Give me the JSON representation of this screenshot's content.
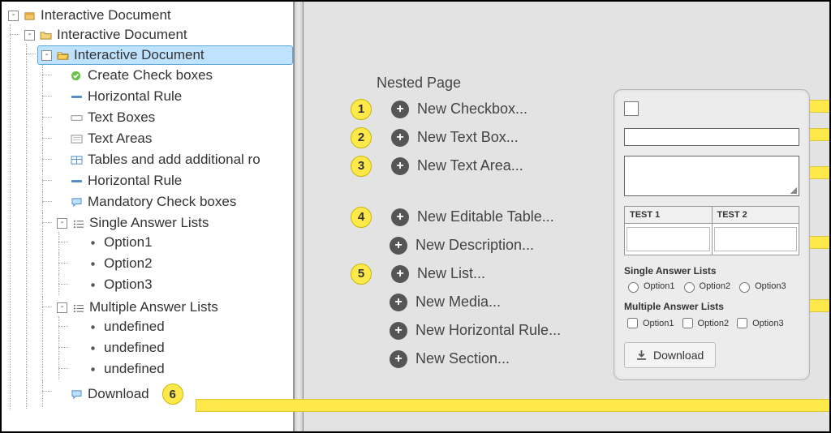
{
  "tree": {
    "root": {
      "label": "Interactive Document",
      "children": [
        {
          "label": "Interactive Document",
          "children": [
            {
              "label": "Interactive Document",
              "selected": true,
              "children": [
                {
                  "label": "Create Check boxes",
                  "icon": "check"
                },
                {
                  "label": "Horizontal Rule",
                  "icon": "hr"
                },
                {
                  "label": "Text Boxes",
                  "icon": "textbox"
                },
                {
                  "label": "Text Areas",
                  "icon": "textarea"
                },
                {
                  "label": "Tables and add additional ro",
                  "icon": "table"
                },
                {
                  "label": "Horizontal Rule",
                  "icon": "hr"
                },
                {
                  "label": "Mandatory Check boxes",
                  "icon": "comment"
                },
                {
                  "label": "Single Answer Lists",
                  "icon": "list",
                  "children": [
                    {
                      "label": "Option1",
                      "icon": "bullet"
                    },
                    {
                      "label": "Option2",
                      "icon": "bullet"
                    },
                    {
                      "label": "Option3",
                      "icon": "bullet"
                    }
                  ]
                },
                {
                  "label": "Multiple Answer Lists",
                  "icon": "list",
                  "children": [
                    {
                      "label": "undefined",
                      "icon": "bullet"
                    },
                    {
                      "label": "undefined",
                      "icon": "bullet"
                    },
                    {
                      "label": "undefined",
                      "icon": "bullet"
                    }
                  ]
                },
                {
                  "label": "Download",
                  "icon": "comment",
                  "badge": "6"
                }
              ]
            }
          ]
        }
      ]
    }
  },
  "page_title": "Nested Page",
  "actions": [
    {
      "badge": "1",
      "label": "New Checkbox...",
      "arrow": true
    },
    {
      "badge": "2",
      "label": "New Text Box...",
      "arrow": true
    },
    {
      "badge": "3",
      "label": "New Text Area...",
      "arrow": true
    },
    {
      "gap": true
    },
    {
      "badge": "4",
      "label": "New Editable Table...",
      "arrow": true
    },
    {
      "badge": "",
      "label": "New Description...",
      "arrow": false
    },
    {
      "badge": "5",
      "label": "New List...",
      "arrow": true
    },
    {
      "badge": "",
      "label": "New Media...",
      "arrow": false
    },
    {
      "badge": "",
      "label": "New Horizontal Rule...",
      "arrow": false
    },
    {
      "badge": "",
      "label": "New Section...",
      "arrow": false
    }
  ],
  "preview": {
    "table_headers": [
      "TEST 1",
      "TEST 2"
    ],
    "single_title": "Single Answer Lists",
    "single_opts": [
      "Option1",
      "Option2",
      "Option3"
    ],
    "multi_title": "Multiple Answer Lists",
    "multi_opts": [
      "Option1",
      "Option2",
      "Option3"
    ],
    "download_label": "Download"
  }
}
